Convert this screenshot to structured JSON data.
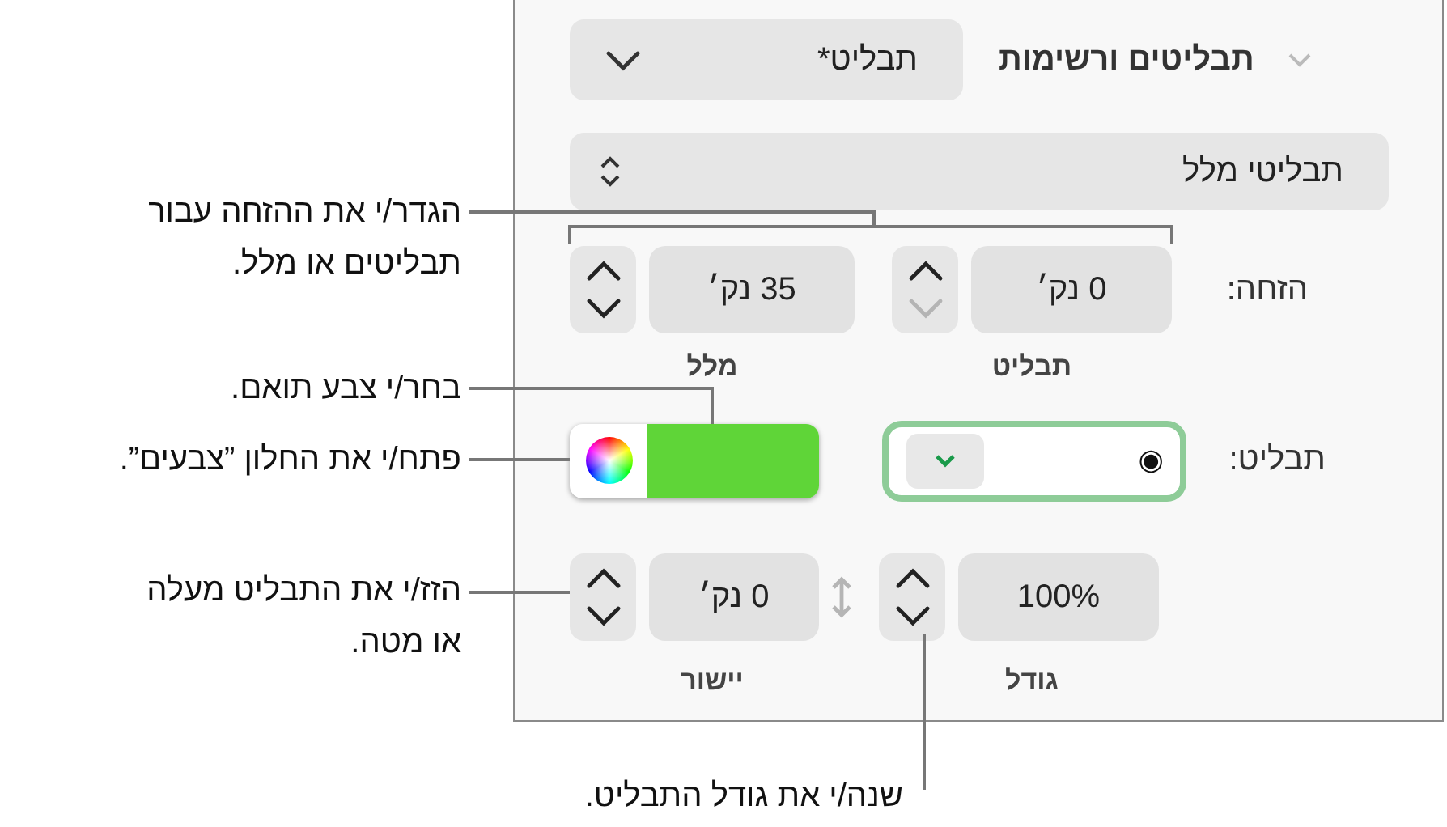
{
  "panel": {
    "title": "תבליטים ורשימות",
    "expanded": true,
    "style_popup": "תבליט*",
    "list_popup": "תבליטי מלל",
    "indent": {
      "label": "הזחה:",
      "fields": [
        {
          "value": "0 נק׳",
          "caption": "תבליט",
          "down_disabled": true
        },
        {
          "value": "35 נק׳",
          "caption": "מלל",
          "down_disabled": false
        }
      ]
    },
    "bullet": {
      "label": "תבליט:",
      "symbol": "◉",
      "color": "#5fd538"
    },
    "position": {
      "fields": [
        {
          "kind": "size",
          "value": "100%",
          "caption": "גודל",
          "down_disabled": false
        },
        {
          "kind": "align",
          "value": "0 נק׳",
          "caption": "יישור",
          "down_disabled": false
        }
      ]
    }
  },
  "callouts": [
    {
      "text": "הגדר/י את ההזחה עבור תבליטים או מלל."
    },
    {
      "text": "בחר/י צבע תואם."
    },
    {
      "text": "פתח/י את החלון ”צבעים”."
    },
    {
      "text": "הזז/י את התבליט מעלה או מטה."
    },
    {
      "text": "שנה/י את גודל התבליט."
    }
  ]
}
